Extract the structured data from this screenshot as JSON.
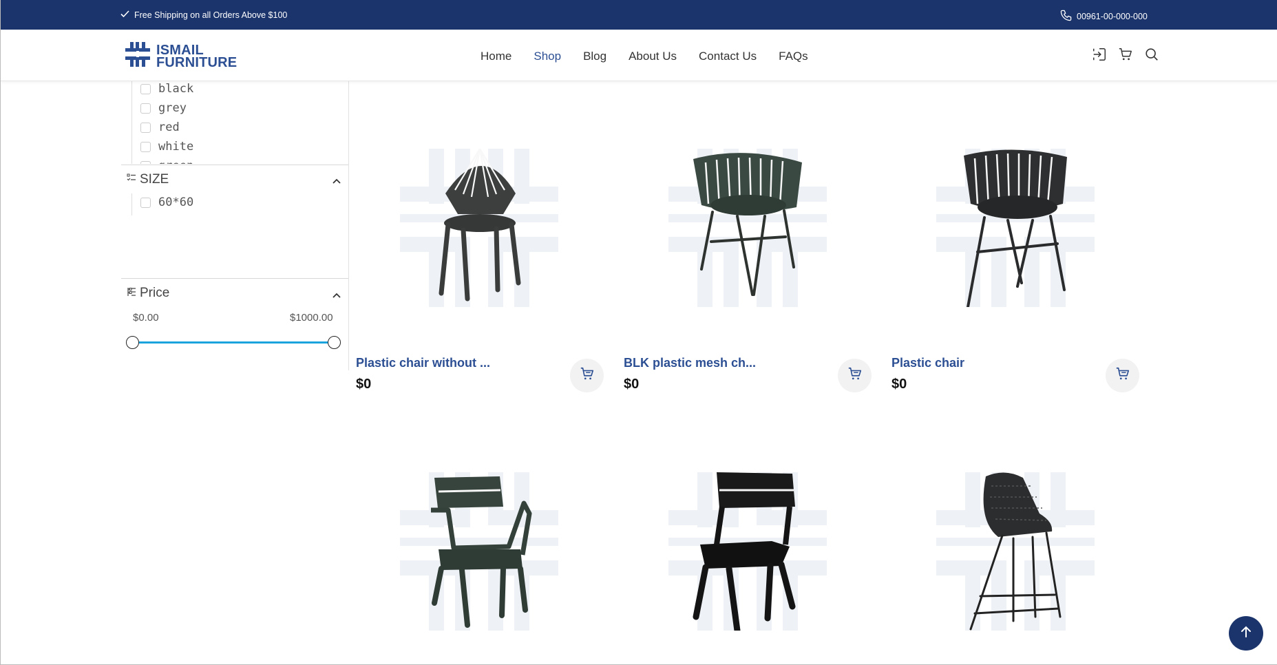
{
  "topbar": {
    "shipping_text": "Free Shipping on all Orders Above $100",
    "phone": "00961-00-000-000"
  },
  "header": {
    "logo_line1": "ISMAIL",
    "logo_line2": "FURNITURE",
    "nav": [
      {
        "label": "Home"
      },
      {
        "label": "Shop",
        "active": true
      },
      {
        "label": "Blog"
      },
      {
        "label": "About Us"
      },
      {
        "label": "Contact Us"
      },
      {
        "label": "FAQs"
      }
    ],
    "icons": [
      "login-icon",
      "cart-icon",
      "search-icon"
    ]
  },
  "filters": {
    "colors": [
      "black",
      "grey",
      "red",
      "white",
      "green"
    ],
    "size_title": "SIZE",
    "sizes": [
      "60*60"
    ],
    "price_title": "Price",
    "price_min": "$0.00",
    "price_max": "$1000.00",
    "price_range_fraction": [
      0,
      1
    ]
  },
  "products": [
    {
      "title": "Plastic chair without ...",
      "price": "$0"
    },
    {
      "title": "BLK plastic mesh ch...",
      "price": "$0"
    },
    {
      "title": "Plastic chair",
      "price": "$0"
    }
  ],
  "colors": {
    "brand": "#1b346c",
    "accent": "#2c4f94",
    "slider": "#1aa3dd"
  }
}
